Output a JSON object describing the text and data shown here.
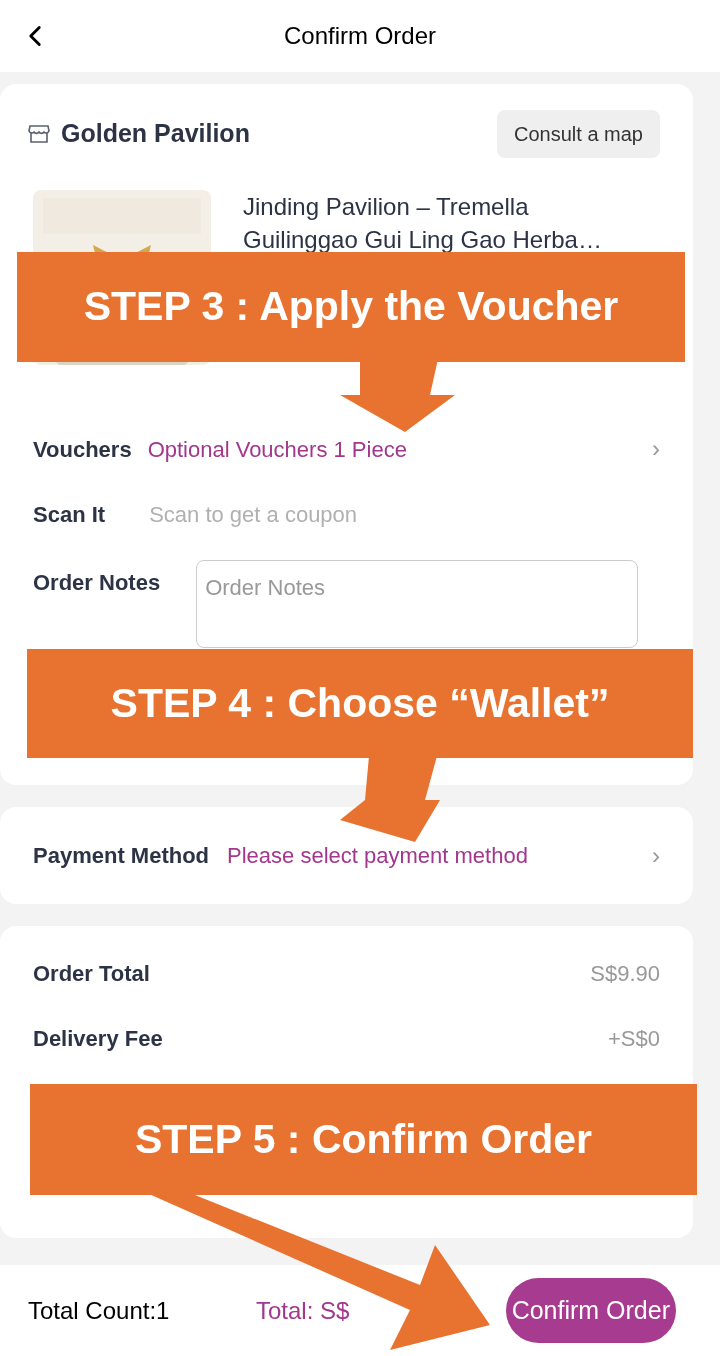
{
  "header": {
    "title": "Confirm Order"
  },
  "store": {
    "name": "Golden Pavilion",
    "map_button": "Consult a map"
  },
  "product": {
    "title": "Jinding Pavilion – Tremella Guilinggao Gui Ling Gao Herba…"
  },
  "vouchers": {
    "label": "Vouchers",
    "value": "Optional Vouchers 1 Piece",
    "chevron": "›"
  },
  "scan": {
    "label": "Scan It",
    "placeholder": "Scan to get a coupon"
  },
  "notes": {
    "label": "Order Notes",
    "placeholder": "Order Notes"
  },
  "payment": {
    "label": "Payment Method",
    "value": "Please select payment method",
    "chevron": "›"
  },
  "summary": [
    {
      "label": "Order Total",
      "value": "S$9.90"
    },
    {
      "label": "Delivery Fee",
      "value": "+S$0"
    }
  ],
  "bottom_bar": {
    "count": "Total Count:1",
    "total": "Total: S$",
    "button": "Confirm Order"
  },
  "annotations": [
    {
      "text": "STEP 3 : Apply the Voucher"
    },
    {
      "text": "STEP 4 : Choose “Wallet”"
    },
    {
      "text": "STEP 5 : Confirm Order"
    }
  ]
}
